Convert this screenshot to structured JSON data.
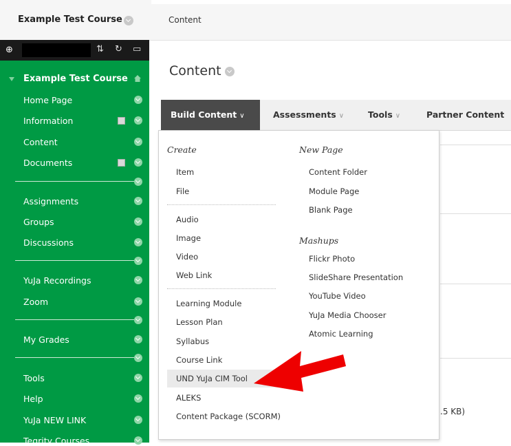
{
  "topbar": {
    "course_title": "Example Test Course",
    "breadcrumb": "Content"
  },
  "sidebar": {
    "course_title": "Example Test Course",
    "items": [
      {
        "label": "Home Page"
      },
      {
        "label": "Information"
      },
      {
        "label": "Content"
      },
      {
        "label": "Documents"
      },
      {
        "label": "Assignments"
      },
      {
        "label": "Groups"
      },
      {
        "label": "Discussions"
      },
      {
        "label": "YuJa Recordings"
      },
      {
        "label": "Zoom"
      },
      {
        "label": "My Grades"
      },
      {
        "label": "Tools"
      },
      {
        "label": "Help"
      },
      {
        "label": "YuJa NEW LINK"
      },
      {
        "label": "Tegrity Courses"
      }
    ],
    "tool_icons": [
      "add-icon",
      "sort-icon",
      "refresh-icon",
      "folder-icon"
    ]
  },
  "main": {
    "title": "Content",
    "partial_text": ".5 KB)"
  },
  "menubar": {
    "tabs": [
      {
        "label": "Build Content"
      },
      {
        "label": "Assessments"
      },
      {
        "label": "Tools"
      },
      {
        "label": "Partner Content"
      }
    ]
  },
  "dropdown": {
    "create_heading": "Create",
    "create_items": [
      "Item",
      "File",
      "Audio",
      "Image",
      "Video",
      "Web Link",
      "Learning Module",
      "Lesson Plan",
      "Syllabus",
      "Course Link",
      "UND YuJa CIM Tool",
      "ALEKS",
      "Content Package (SCORM)"
    ],
    "newpage_heading": "New Page",
    "newpage_items": [
      "Content Folder",
      "Module Page",
      "Blank Page"
    ],
    "mashups_heading": "Mashups",
    "mashups_items": [
      "Flickr Photo",
      "SlideShare Presentation",
      "YouTube Video",
      "YuJa Media Chooser",
      "Atomic Learning"
    ]
  },
  "colors": {
    "sidebar": "#009a44",
    "active_tab": "#4a4a4a",
    "arrow": "#ee0000"
  }
}
